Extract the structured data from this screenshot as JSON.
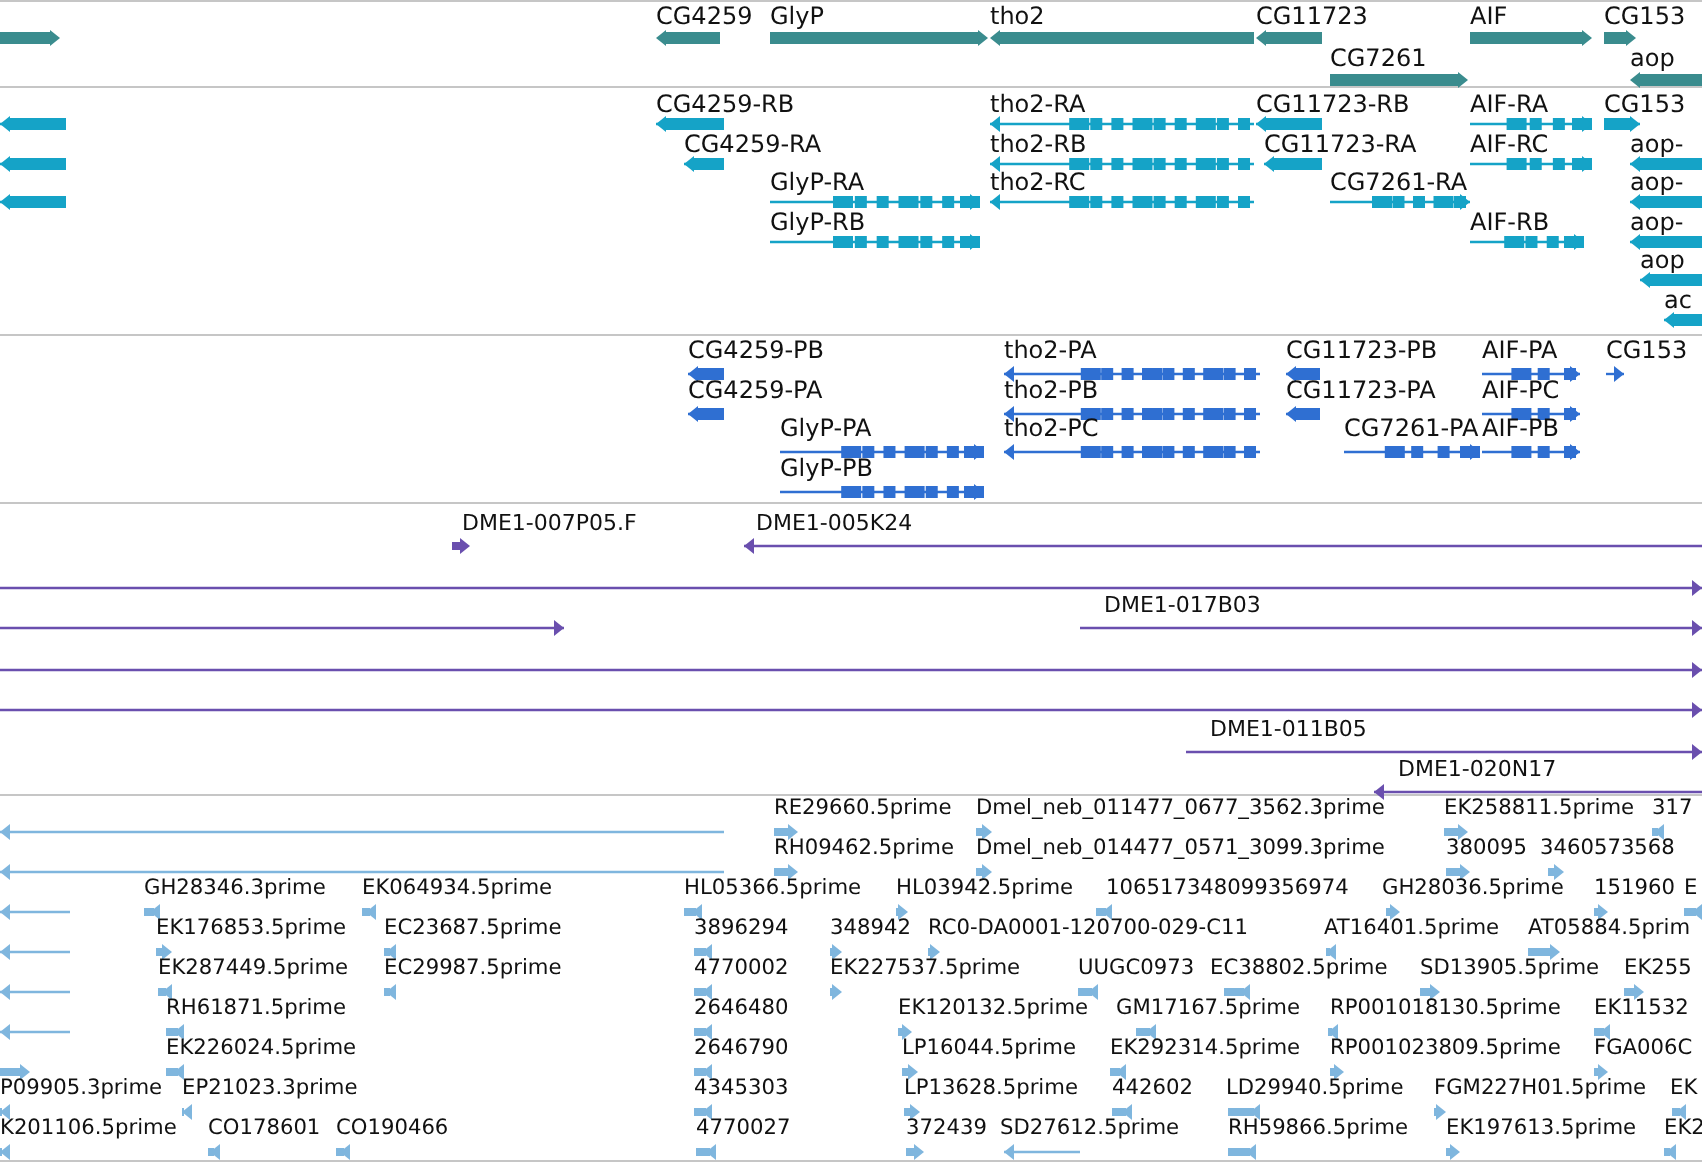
{
  "tracks": [
    {
      "kind": "gene",
      "rows": [
        {
          "features": [
            {
              "reverse": false
            },
            {
              "label": "CG4259",
              "reverse": true
            },
            {
              "label": "GlyP",
              "reverse": false
            },
            {
              "label": "tho2",
              "reverse": true
            },
            {
              "label": "CG11723",
              "reverse": true
            },
            {
              "label": "AIF",
              "reverse": false
            },
            {
              "label": "CG153",
              "reverse": false
            }
          ]
        },
        {
          "features": [
            {
              "label": "CG7261",
              "reverse": false
            },
            {
              "label": "aop",
              "reverse": true
            }
          ]
        }
      ]
    },
    {
      "kind": "transcript",
      "rows": [
        {
          "features": [
            {
              "reverse": true
            },
            {
              "label": "CG4259-RB",
              "reverse": true
            },
            {
              "label": "tho2-RA",
              "reverse": true
            },
            {
              "label": "CG11723-RB",
              "reverse": true
            },
            {
              "label": "AIF-RA",
              "reverse": false
            },
            {
              "label": "CG153",
              "reverse": false
            }
          ]
        },
        {
          "features": [
            {
              "reverse": true
            },
            {
              "label": "CG4259-RA",
              "reverse": true
            },
            {
              "label": "tho2-RB",
              "reverse": true
            },
            {
              "label": "CG11723-RA",
              "reverse": true
            },
            {
              "label": "AIF-RC",
              "reverse": false
            },
            {
              "label": "aop-",
              "reverse": true
            }
          ]
        },
        {
          "features": [
            {
              "reverse": true
            },
            {
              "label": "GlyP-RA",
              "reverse": false
            },
            {
              "label": "tho2-RC",
              "reverse": true
            },
            {
              "label": "CG7261-RA",
              "reverse": false
            },
            {
              "label": "aop-",
              "reverse": true
            }
          ]
        },
        {
          "features": [
            {
              "label": "GlyP-RB",
              "reverse": false
            },
            {
              "label": "AIF-RB",
              "reverse": false
            },
            {
              "label": "aop-",
              "reverse": true
            }
          ]
        },
        {
          "features": [
            {
              "label": "aop",
              "reverse": true
            }
          ]
        },
        {
          "features": [
            {
              "label": "ac",
              "reverse": true
            }
          ]
        }
      ]
    },
    {
      "kind": "protein",
      "rows": [
        {
          "features": [
            {
              "label": "CG4259-PB",
              "reverse": true
            },
            {
              "label": "tho2-PA",
              "reverse": true
            },
            {
              "label": "CG11723-PB",
              "reverse": true
            },
            {
              "label": "AIF-PA",
              "reverse": false
            },
            {
              "label": "CG153",
              "reverse": false
            }
          ]
        },
        {
          "features": [
            {
              "label": "CG4259-PA",
              "reverse": true
            },
            {
              "label": "tho2-PB",
              "reverse": true
            },
            {
              "label": "CG11723-PA",
              "reverse": true
            },
            {
              "label": "AIF-PC",
              "reverse": false
            }
          ]
        },
        {
          "features": [
            {
              "label": "GlyP-PA",
              "reverse": false
            },
            {
              "label": "tho2-PC",
              "reverse": true
            },
            {
              "label": "CG7261-PA",
              "reverse": false
            },
            {
              "label": "AIF-PB",
              "reverse": false
            }
          ]
        },
        {
          "features": [
            {
              "label": "GlyP-PB",
              "reverse": false
            }
          ]
        }
      ]
    },
    {
      "kind": "clone",
      "rows": [
        {
          "features": [
            {
              "label": "DME1-007P05.F",
              "reverse": false
            },
            {
              "label": "DME1-005K24",
              "reverse": true
            }
          ]
        },
        {
          "features": [
            {
              "reverse": false
            }
          ]
        },
        {
          "features": [
            {
              "reverse": false
            },
            {
              "label": "DME1-017B03",
              "reverse": false
            }
          ]
        },
        {
          "features": [
            {
              "reverse": false
            }
          ]
        },
        {
          "features": [
            {
              "reverse": false
            }
          ]
        },
        {
          "features": [
            {
              "label": "DME1-011B05",
              "reverse": false
            }
          ]
        },
        {
          "features": [
            {
              "label": "DME1-020N17",
              "reverse": true
            }
          ]
        }
      ]
    },
    {
      "kind": "est",
      "rows": [
        {
          "features": [
            {
              "reverse": true
            },
            {
              "label": "RE29660.5prime",
              "reverse": false
            },
            {
              "label": "Dmel_neb_011477_0677_3562.3prime",
              "reverse": false
            },
            {
              "label": "EK258811.5prime",
              "reverse": false
            },
            {
              "label": "317",
              "reverse": true
            }
          ]
        },
        {
          "features": [
            {
              "reverse": true
            },
            {
              "label": "RH09462.5prime",
              "reverse": false
            },
            {
              "label": "Dmel_neb_014477_0571_3099.3prime",
              "reverse": false
            },
            {
              "label": "380095",
              "reverse": false
            },
            {
              "label": "3460573568",
              "reverse": false
            }
          ]
        },
        {
          "features": [
            {
              "reverse": true
            },
            {
              "label": "GH28346.3prime",
              "reverse": true
            },
            {
              "label": "EK064934.5prime",
              "reverse": true
            },
            {
              "label": "HL05366.5prime",
              "reverse": true
            },
            {
              "label": "HL03942.5prime",
              "reverse": false
            },
            {
              "label": "106517348099356974",
              "reverse": true
            },
            {
              "label": "GH28036.5prime",
              "reverse": false
            },
            {
              "label": "151960",
              "reverse": false
            },
            {
              "label": "E",
              "reverse": true
            }
          ]
        },
        {
          "features": [
            {
              "reverse": true
            },
            {
              "label": "EK176853.5prime",
              "reverse": false
            },
            {
              "label": "EC23687.5prime",
              "reverse": true
            },
            {
              "label": "3896294",
              "reverse": true
            },
            {
              "label": "348942",
              "reverse": false
            },
            {
              "label": "RC0-DA0001-120700-029-C11",
              "reverse": false
            },
            {
              "label": "AT16401.5prime",
              "reverse": true
            },
            {
              "label": "AT05884.5prim",
              "reverse": false
            }
          ]
        },
        {
          "features": [
            {
              "reverse": true
            },
            {
              "label": "EK287449.5prime",
              "reverse": true
            },
            {
              "label": "EC29987.5prime",
              "reverse": true
            },
            {
              "label": "4770002",
              "reverse": true
            },
            {
              "label": "EK227537.5prime",
              "reverse": false
            },
            {
              "label": "UUGC0973",
              "reverse": true
            },
            {
              "label": "EC38802.5prime",
              "reverse": true
            },
            {
              "label": "SD13905.5prime",
              "reverse": false
            },
            {
              "label": "EK255",
              "reverse": false
            }
          ]
        },
        {
          "features": [
            {
              "reverse": true
            },
            {
              "label": "RH61871.5prime",
              "reverse": true
            },
            {
              "label": "2646480",
              "reverse": true
            },
            {
              "label": "EK120132.5prime",
              "reverse": false
            },
            {
              "label": "GM17167.5prime",
              "reverse": true
            },
            {
              "label": "RP001018130.5prime",
              "reverse": true
            },
            {
              "label": "EK11532",
              "reverse": true
            }
          ]
        },
        {
          "features": [
            {
              "reverse": false
            },
            {
              "label": "EK226024.5prime",
              "reverse": true
            },
            {
              "label": "2646790",
              "reverse": true
            },
            {
              "label": "LP16044.5prime",
              "reverse": false
            },
            {
              "label": "EK292314.5prime",
              "reverse": true
            },
            {
              "label": "RP001023809.5prime",
              "reverse": false
            },
            {
              "label": "FGA006C",
              "reverse": false
            }
          ]
        },
        {
          "features": [
            {
              "label": "P09905.3prime",
              "reverse": true
            },
            {
              "label": "EP21023.3prime",
              "reverse": true
            },
            {
              "label": "4345303",
              "reverse": true
            },
            {
              "label": "LP13628.5prime",
              "reverse": false
            },
            {
              "label": "442602",
              "reverse": true
            },
            {
              "label": "LD29940.5prime",
              "reverse": true
            },
            {
              "label": "FGM227H01.5prime",
              "reverse": false
            },
            {
              "label": "EK",
              "reverse": true
            }
          ]
        },
        {
          "features": [
            {
              "label": "K201106.5prime",
              "reverse": true
            },
            {
              "label": "CO178601",
              "reverse": true
            },
            {
              "label": "CO190466",
              "reverse": true
            },
            {
              "label": "4770027",
              "reverse": true
            },
            {
              "label": "372439",
              "reverse": false
            },
            {
              "label": "SD27612.5prime",
              "reverse": true
            },
            {
              "label": "RH59866.5prime",
              "reverse": true
            },
            {
              "label": "EK197613.5prime",
              "reverse": false
            },
            {
              "label": "EK2",
              "reverse": true
            }
          ]
        }
      ]
    }
  ]
}
